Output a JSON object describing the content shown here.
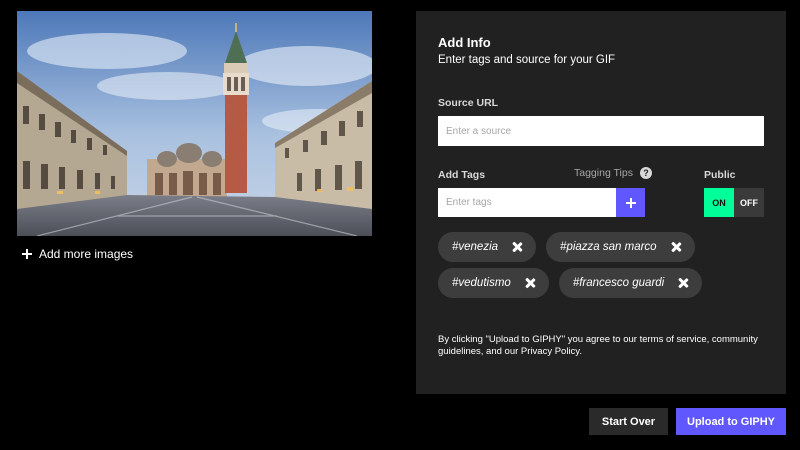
{
  "preview": {
    "image": "venice-piazza-san-marco-photo"
  },
  "add_more": {
    "label": "Add more images",
    "icon": "plus-icon"
  },
  "panel": {
    "title": "Add Info",
    "subtitle": "Enter tags and source for your GIF",
    "source": {
      "label": "Source URL",
      "placeholder": "Enter a source",
      "value": ""
    },
    "tags_input": {
      "label": "Add Tags",
      "placeholder": "Enter tags",
      "value": "",
      "add_icon": "plus-icon"
    },
    "tagging_tips": {
      "label": "Tagging Tips",
      "icon": "question-icon",
      "glyph": "?"
    },
    "public": {
      "label": "Public",
      "on_label": "ON",
      "off_label": "OFF",
      "state": "on"
    },
    "tags": [
      {
        "text": "#venezia"
      },
      {
        "text": "#piazza san marco"
      },
      {
        "text": "#vedutismo"
      },
      {
        "text": "#francesco guardi"
      }
    ],
    "disclaimer": "By clicking \"Upload to GIPHY\" you agree to our terms of service, community guidelines, and our Privacy Policy."
  },
  "actions": {
    "start_over": "Start Over",
    "upload": "Upload to GIPHY"
  },
  "colors": {
    "accent": "#6157ff",
    "toggle_on": "#00ff99",
    "panel_bg": "#212121",
    "chip_bg": "#3d3d3d"
  }
}
